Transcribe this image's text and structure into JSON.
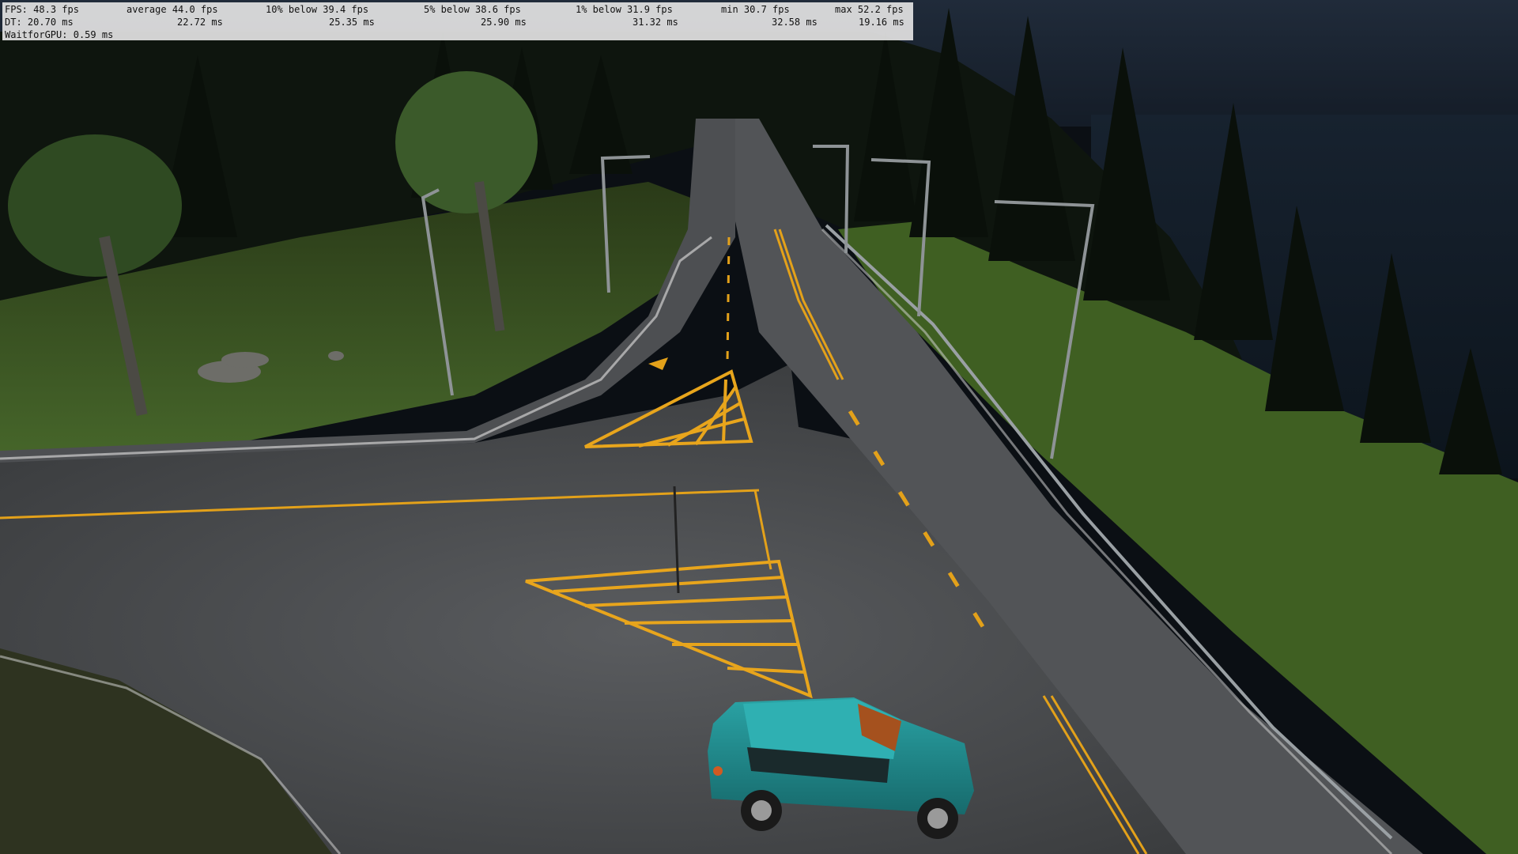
{
  "stats": {
    "fps_label": "FPS:",
    "fps_value": "48.3 fps",
    "dt_label": "DT:",
    "dt_value": "20.70 ms",
    "wait_label": "WaitforGPU:",
    "wait_value": "0.59 ms",
    "columns": [
      {
        "label": "average",
        "fps": "44.0 fps",
        "ms": "22.72 ms"
      },
      {
        "label": "10% below",
        "fps": "39.4 fps",
        "ms": "25.35 ms"
      },
      {
        "label": "5% below",
        "fps": "38.6 fps",
        "ms": "25.90 ms"
      },
      {
        "label": "1% below",
        "fps": "31.9 fps",
        "ms": "31.32 ms"
      },
      {
        "label": "min",
        "fps": "30.7 fps",
        "ms": "32.58 ms"
      },
      {
        "label": "max",
        "fps": "52.2 fps",
        "ms": "19.16 ms"
      }
    ]
  },
  "scene": {
    "colors": {
      "sky": "#1a2433",
      "sea": "#0f1a26",
      "grass": "#3e5a22",
      "asphalt": "#4a4c4f",
      "yellow_marking": "#e3a11a",
      "car_body": "#1f8a8c"
    }
  }
}
